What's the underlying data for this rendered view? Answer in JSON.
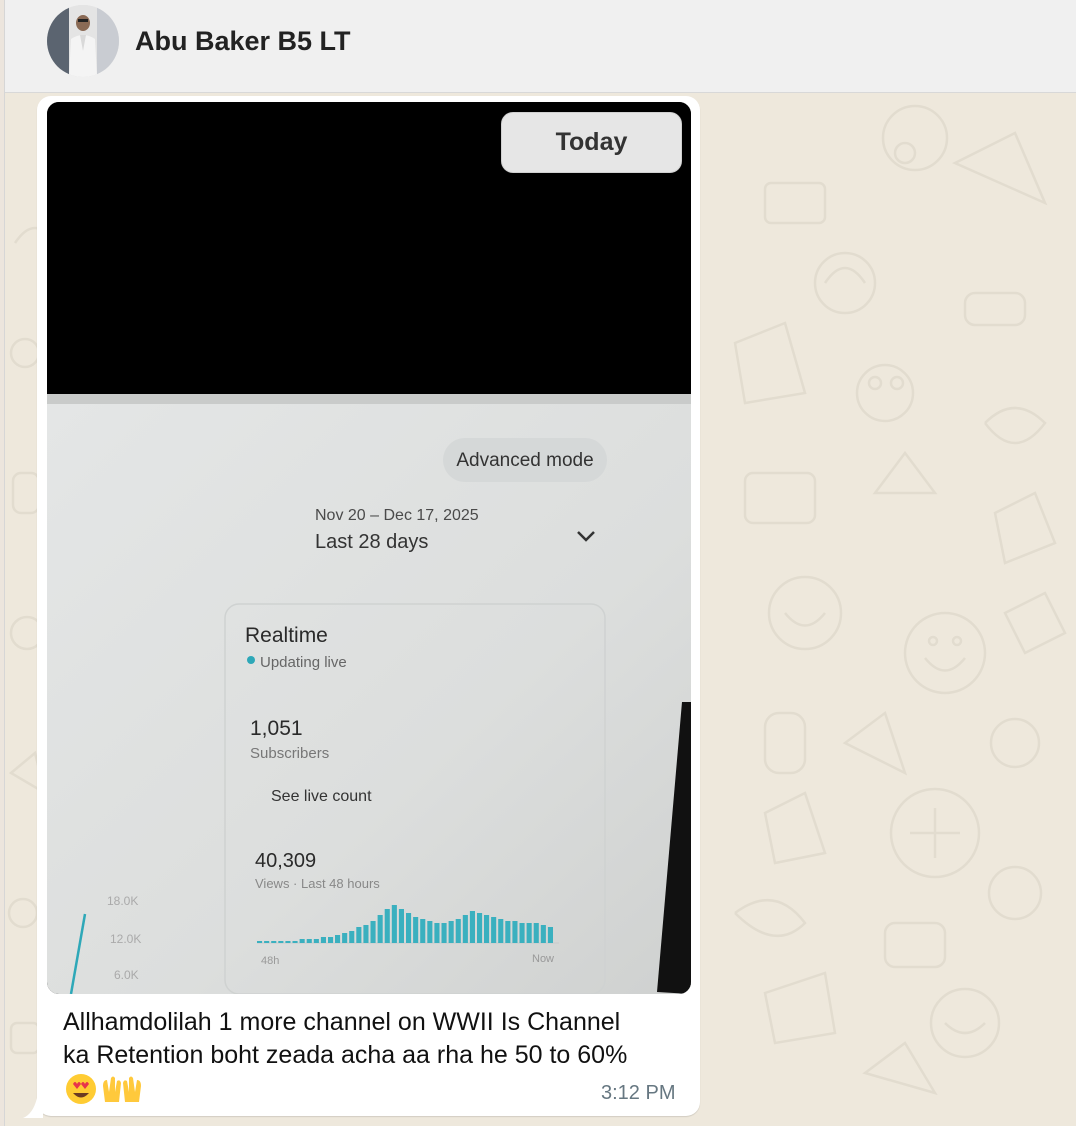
{
  "header": {
    "contact_name": "Abu Baker B5 LT"
  },
  "chat": {
    "date_chip": "Today",
    "message": {
      "caption_line1": "Allhamdolilah 1 more channel on WWII Is Channel",
      "caption_line2": "ka Retention boht zeada acha aa rha he 50 to  60%",
      "emojis": [
        "heart-eyes-emoji",
        "raised-hands-emoji"
      ],
      "time": "3:12 PM"
    },
    "photo": {
      "advanced_mode": "Advanced mode",
      "date_range": "Nov 20 – Dec 17, 2025",
      "period": "Last 28 days",
      "realtime_title": "Realtime",
      "updating_live": "Updating live",
      "subscribers_value": "1,051",
      "subscribers_label": "Subscribers",
      "see_live_count": "See live count",
      "views_value": "40,309",
      "views_label": "Views · Last 48 hours",
      "y_ticks": [
        "18.0K",
        "12.0K",
        "6.0K"
      ],
      "x_start": "48h",
      "x_end": "Now"
    }
  },
  "chart_data": {
    "type": "bar",
    "xlabel": "",
    "ylabel": "",
    "x_ticks": [
      "48h",
      "Now"
    ],
    "values": [
      1,
      1,
      1,
      1,
      1,
      1,
      2,
      2,
      2,
      3,
      3,
      4,
      5,
      6,
      8,
      9,
      11,
      14,
      17,
      19,
      17,
      15,
      13,
      12,
      11,
      10,
      10,
      11,
      12,
      14,
      16,
      15,
      14,
      13,
      12,
      11,
      11,
      10,
      10,
      10,
      9,
      8
    ]
  },
  "colors": {
    "bubble": "#ffffff",
    "wallpaper": "#eee8dc",
    "bar": "#3ab0bf",
    "header": "#f0f0f0"
  }
}
